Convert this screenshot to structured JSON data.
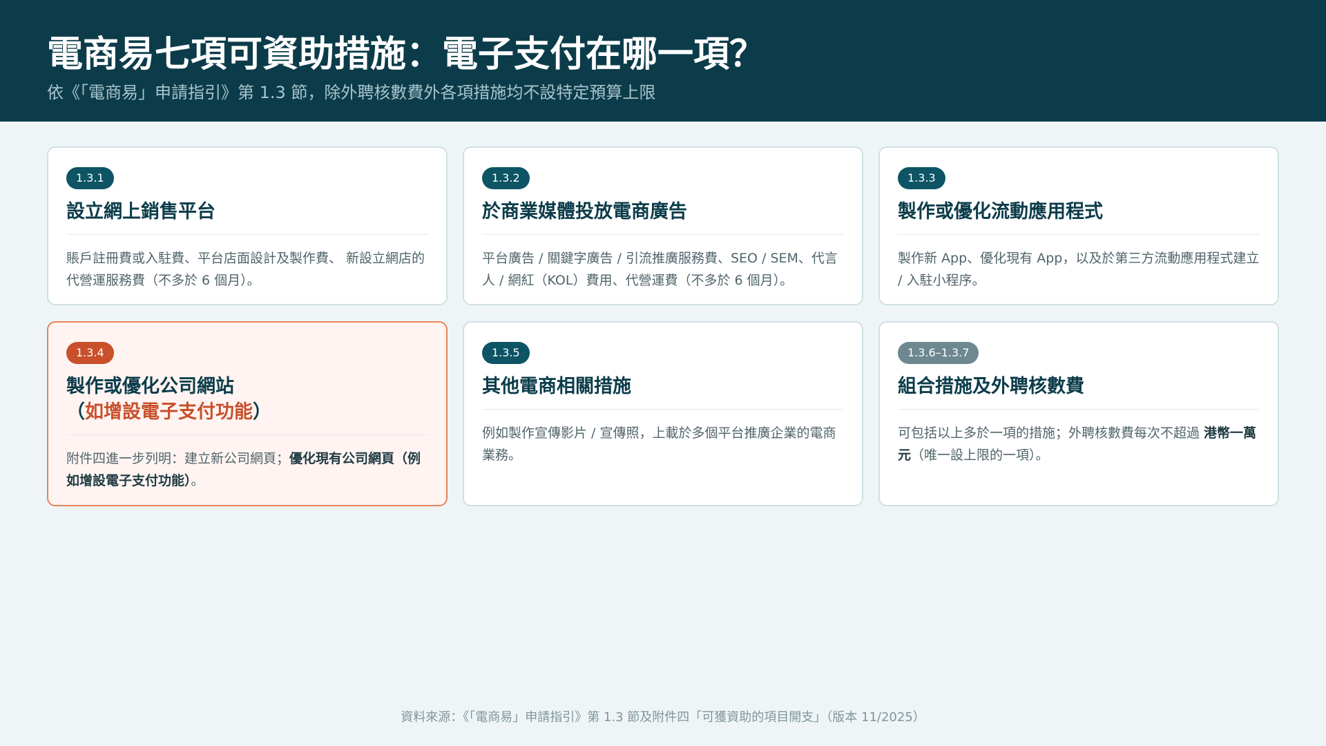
{
  "header": {
    "title": "電商易七項可資助措施：電子支付在哪一項？",
    "subtitle": "依《「電商易」申請指引》第 1.3 節，除外聘核數費外各項措施均不設特定預算上限"
  },
  "cards": [
    {
      "badge": "1.3.1",
      "title": "設立網上銷售平台",
      "body": "賬戶註冊費或入駐費、平台店面設計及製作費、 新設立網店的代營運服務費（不多於 6 個月）。"
    },
    {
      "badge": "1.3.2",
      "title": "於商業媒體投放電商廣告",
      "body": "平台廣告 / 關鍵字廣告 / 引流推廣服務費、SEO / SEM、代言人 / 網紅（KOL）費用、代營運費（不多於 6 個月）。"
    },
    {
      "badge": "1.3.3",
      "title": "製作或優化流動應用程式",
      "body": "製作新 App、優化現有 App，以及於第三方流動應用程式建立 / 入駐小程序。"
    },
    {
      "badge": "1.3.4",
      "title_line1": "製作或優化公司網站",
      "title_open": "（",
      "title_accent": "如增設電子支付功能",
      "title_close": "）",
      "body_prefix": "附件四進一步列明：建立新公司網頁；",
      "body_bold": "優化現有公司網頁（例如增設電子支付功能）",
      "body_suffix": "。"
    },
    {
      "badge": "1.3.5",
      "title": "其他電商相關措施",
      "body": "例如製作宣傳影片 / 宣傳照，上載於多個平台推廣企業的電商業務。"
    },
    {
      "badge": "1.3.6–1.3.7",
      "title": "組合措施及外聘核數費",
      "body_prefix": "可包括以上多於一項的措施；外聘核數費每次不超過 ",
      "body_bold": "港幣一萬元",
      "body_suffix": "（唯一設上限的一項）。"
    }
  ],
  "footer": "資料來源：《「電商易」申請指引》第 1.3 節及附件四「可獲資助的項目開支」（版本 11/2025）",
  "colors": {
    "header_bg": "#0c3c4a",
    "accent": "#c8502b",
    "badge": "#0d5465",
    "badge_gray": "#6d8890"
  }
}
